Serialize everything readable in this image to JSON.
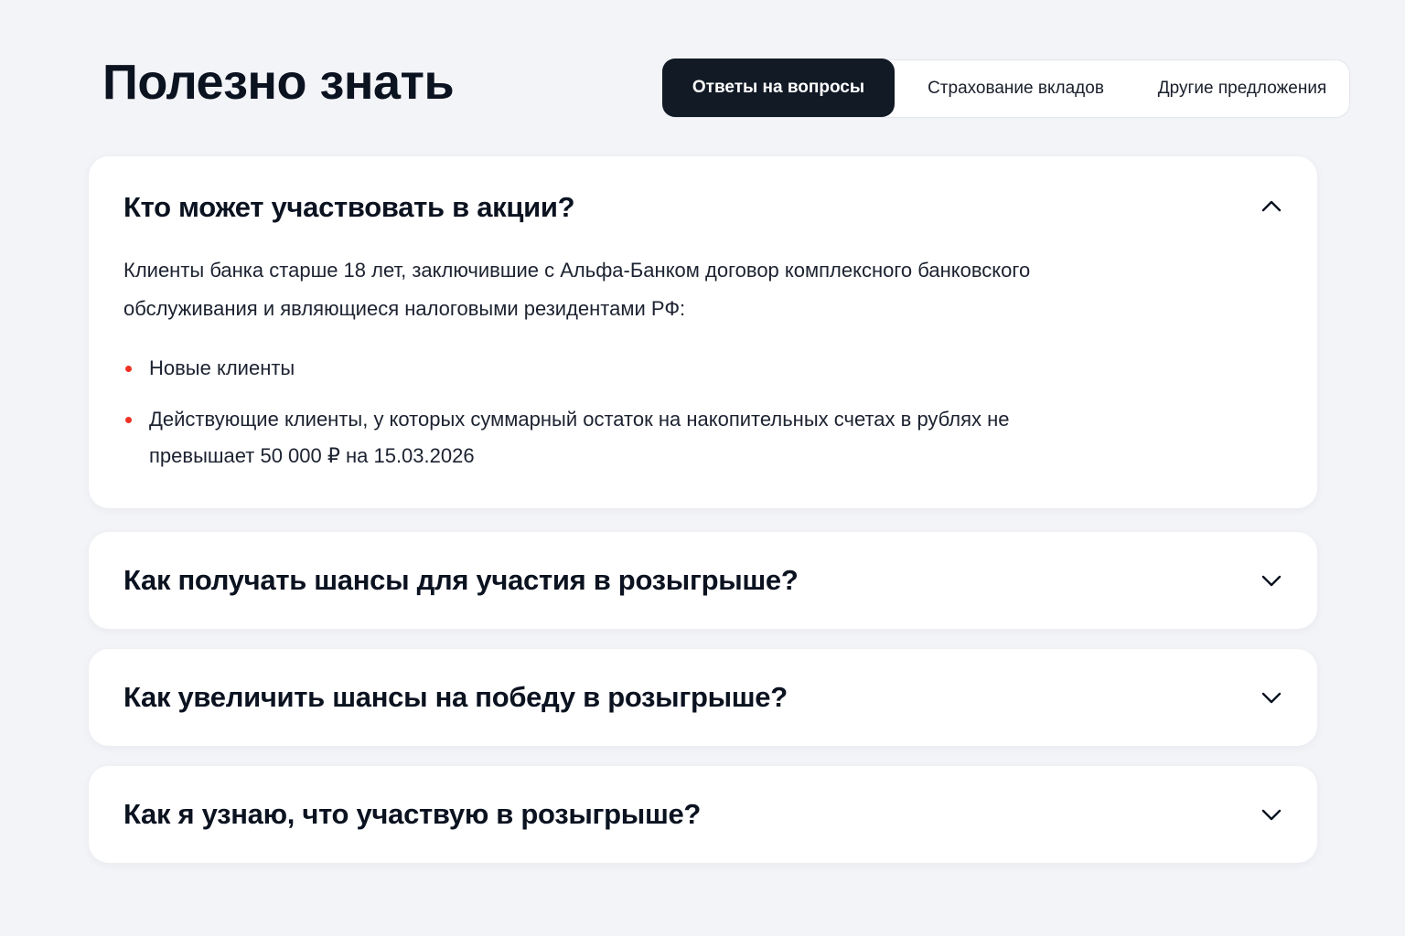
{
  "page": {
    "title": "Полезно знать"
  },
  "tabs": [
    {
      "label": "Ответы на вопросы",
      "active": true
    },
    {
      "label": "Страхование вкладов",
      "active": false
    },
    {
      "label": "Другие предложения",
      "active": false
    }
  ],
  "faq": [
    {
      "question": "Кто может участвовать в акции?",
      "expanded": true,
      "icon": "chevron-up-icon",
      "answer": "Клиенты банка старше 18 лет, заключившие с Альфа-Банком договор комплексного банковского обслуживания и являющиеся налоговыми резидентами РФ:",
      "bullets": [
        "Новые клиенты",
        "Действующие клиенты, у которых суммарный остаток на накопительных счетах в рублях не превышает 50 000 ₽ на 15.03.2026"
      ]
    },
    {
      "question": "Как получать шансы для участия в розыгрыше?",
      "expanded": false,
      "icon": "chevron-down-icon"
    },
    {
      "question": "Как увеличить шансы на победу в розыгрыше?",
      "expanded": false,
      "icon": "chevron-down-icon"
    },
    {
      "question": "Как я узнаю, что участвую в розыгрыше?",
      "expanded": false,
      "icon": "chevron-down-icon"
    }
  ],
  "colors": {
    "background": "#f3f4f8",
    "card": "#ffffff",
    "active_tab": "#121a26",
    "bullet_accent": "#ef3124",
    "text": "#0b1220"
  }
}
